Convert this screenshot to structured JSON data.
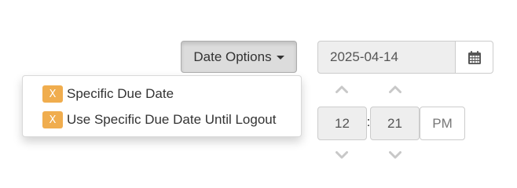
{
  "date_options": {
    "label": "Date Options",
    "menu": [
      {
        "badge": "X",
        "label": "Specific Due Date"
      },
      {
        "badge": "X",
        "label": "Use Specific Due Date Until Logout"
      }
    ]
  },
  "date_picker": {
    "value": "2025-04-14",
    "calendar_icon": "calendar-icon"
  },
  "time_picker": {
    "hour": "12",
    "separator": ":",
    "minute": "21",
    "meridian": "PM",
    "up_icon": "chevron-up-icon",
    "down_icon": "chevron-down-icon"
  },
  "colors": {
    "badge": "#f0ad4e",
    "chevron": "#c8c8c8",
    "input_bg": "#eeeeee"
  }
}
